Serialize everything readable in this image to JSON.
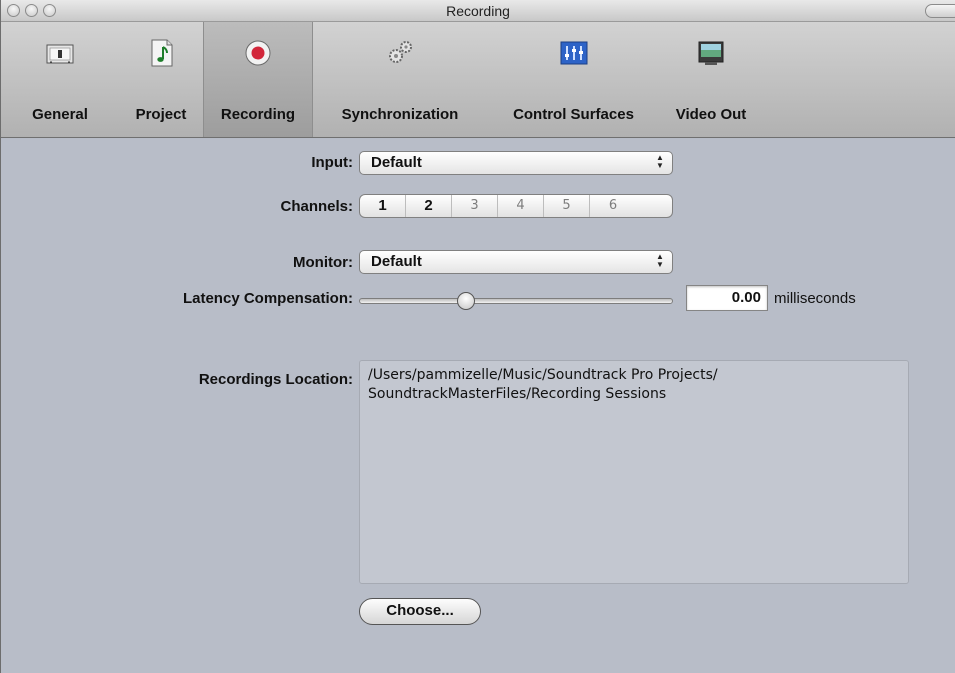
{
  "window": {
    "title": "Recording"
  },
  "toolbar": {
    "items": [
      {
        "label": "General",
        "icon": "general-prefs-icon"
      },
      {
        "label": "Project",
        "icon": "project-music-note-icon"
      },
      {
        "label": "Recording",
        "icon": "record-icon",
        "selected": true
      },
      {
        "label": "Synchronization",
        "icon": "gears-icon"
      },
      {
        "label": "Control Surfaces",
        "icon": "mixer-faders-icon"
      },
      {
        "label": "Video Out",
        "icon": "monitor-icon"
      }
    ]
  },
  "form": {
    "input": {
      "label": "Input:",
      "value": "Default"
    },
    "channels": {
      "label": "Channels:",
      "options": [
        "1",
        "2",
        "3",
        "4",
        "5",
        "6"
      ],
      "enabled_count": 2
    },
    "monitor": {
      "label": "Monitor:",
      "value": "Default"
    },
    "latency": {
      "label": "Latency Compensation:",
      "value": "0.00",
      "unit": "milliseconds",
      "slider_fraction": 0.33
    },
    "recordings_location": {
      "label": "Recordings Location:",
      "path_line1": "/Users/pammizelle/Music/Soundtrack Pro Projects/",
      "path_line2": "SoundtrackMasterFiles/Recording Sessions"
    },
    "choose_button": "Choose..."
  },
  "colors": {
    "record_red": "#d2263a",
    "window_bg": "#b8bdc8"
  }
}
